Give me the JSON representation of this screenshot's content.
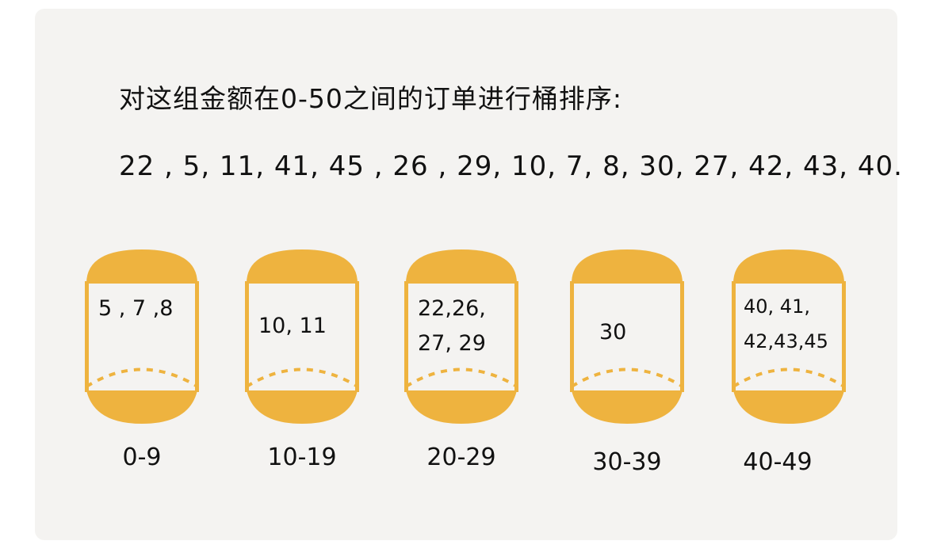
{
  "title": "对这组金额在0-50之间的订单进行桶排序:",
  "numbers": "22 , 5, 11, 41, 45 , 26 , 29, 10, 7, 8, 30, 27, 42, 43, 40.",
  "colors": {
    "bucket": "#eeb33f",
    "outline": "#e9a92c",
    "background": "#f4f3f1"
  },
  "buckets": [
    {
      "lines": [
        "5 , 7 ,8"
      ],
      "range": "0-9"
    },
    {
      "lines": [
        "10, 11"
      ],
      "range": "10-19"
    },
    {
      "lines": [
        "22,26,",
        "27, 29"
      ],
      "range": "20-29"
    },
    {
      "lines": [
        "30"
      ],
      "range": "30-39"
    },
    {
      "lines": [
        "40, 41,",
        "42,43,45"
      ],
      "range": "40-49"
    }
  ]
}
